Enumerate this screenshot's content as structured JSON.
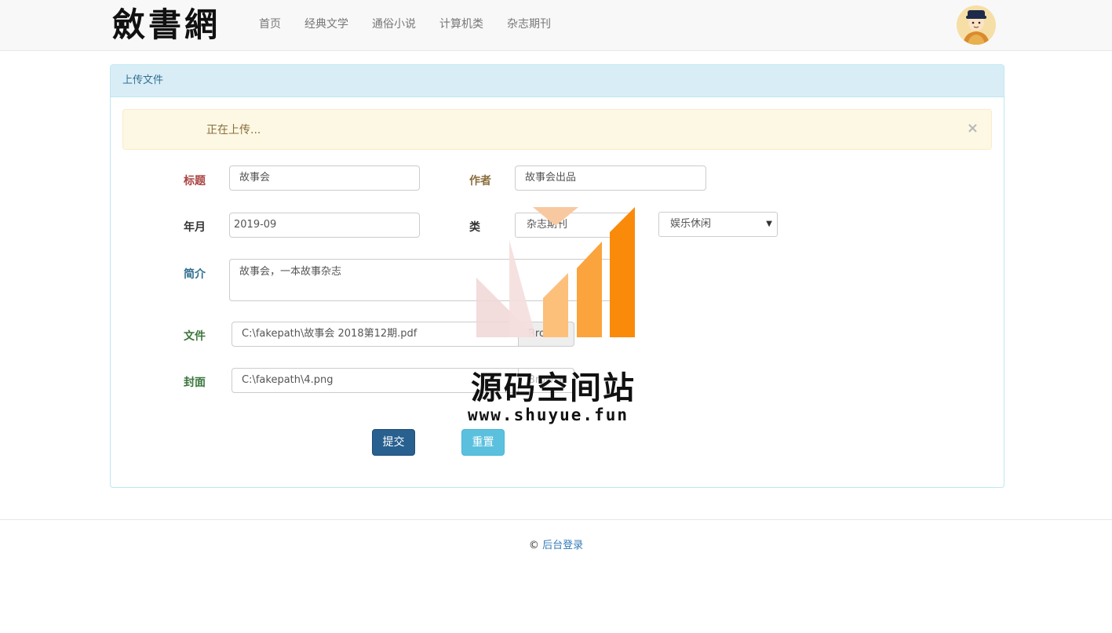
{
  "brand": {
    "logo_text": "斂書網"
  },
  "nav": {
    "items": [
      "首页",
      "经典文学",
      "通俗小说",
      "计算机类",
      "杂志期刊"
    ]
  },
  "panel": {
    "heading": "上传文件"
  },
  "alert": {
    "text": "正在上传...",
    "close": "×"
  },
  "form": {
    "title_label": "标题",
    "title_value": "故事会",
    "author_label": "作者",
    "author_value": "故事会出品",
    "date_label": "年月",
    "date_value": "2019-09",
    "category_label": "类",
    "category_value": "杂志期刊",
    "subcategory_value": "娱乐休闲",
    "intro_label": "简介",
    "intro_value": "故事会，一本故事杂志",
    "file_label": "文件",
    "file_value": "C:\\fakepath\\故事会 2018第12期.pdf",
    "file_browse": "Browse",
    "cover_label": "封面",
    "cover_value": "C:\\fakepath\\4.png",
    "cover_browse": "Browse",
    "submit": "提交",
    "reset": "重置"
  },
  "footer": {
    "copyright": "©",
    "admin_link": "后台登录"
  },
  "watermark": {
    "name": "源码空间站",
    "url": "www.shuyue.fun"
  },
  "colors": {
    "label_title": "#a94442",
    "label_author": "#8a6d3b",
    "label_date": "#333333",
    "label_intro": "#31708f",
    "label_file": "#3c763d",
    "label_cover": "#3c763d",
    "btn_primary": "#286090",
    "btn_info": "#5bc0de"
  }
}
